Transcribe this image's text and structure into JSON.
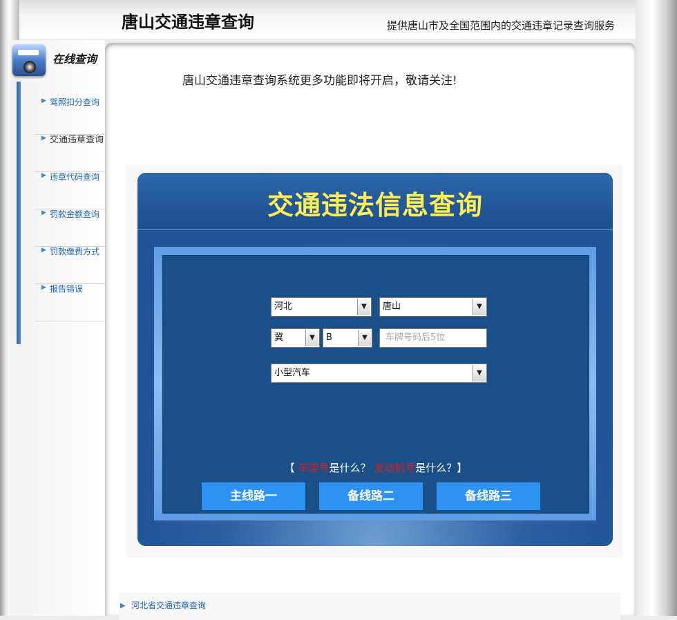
{
  "header": {
    "title": "唐山交通违章查询",
    "tagline": "提供唐山市及全国范围内的交通违章记录查询服务"
  },
  "sidebar": {
    "heading": "在线查询",
    "items": [
      {
        "label": "驾照扣分查询"
      },
      {
        "label": "交通违章查询"
      },
      {
        "label": "违章代码查询"
      },
      {
        "label": "罚款金额查询"
      },
      {
        "label": "罚款缴费方式"
      },
      {
        "label": "报告错误"
      }
    ]
  },
  "main": {
    "notice": "唐山交通违章查询系统更多功能即将开启，敬请关注!",
    "form": {
      "title": "交通违法信息查询",
      "province": "河北",
      "city": "唐山",
      "plate_prefix": "冀",
      "plate_letter": "B",
      "plate_placeholder": "车牌号码后5位",
      "vehicle_type": "小型汽车",
      "help": {
        "open": "【",
        "frame_no": "车架号",
        "q1": "是什么？",
        "engine_no": "发动机号",
        "q2": "是什么？】"
      },
      "buttons": [
        "主线路一",
        "备线路二",
        "备线路三"
      ]
    },
    "footer_link": "河北省交通违章查询"
  },
  "colors": {
    "panel": "#1f5597",
    "title": "#ffee55",
    "button": "#2d93f2",
    "link": "#1f63b6",
    "help_red": "#d81e1e"
  }
}
